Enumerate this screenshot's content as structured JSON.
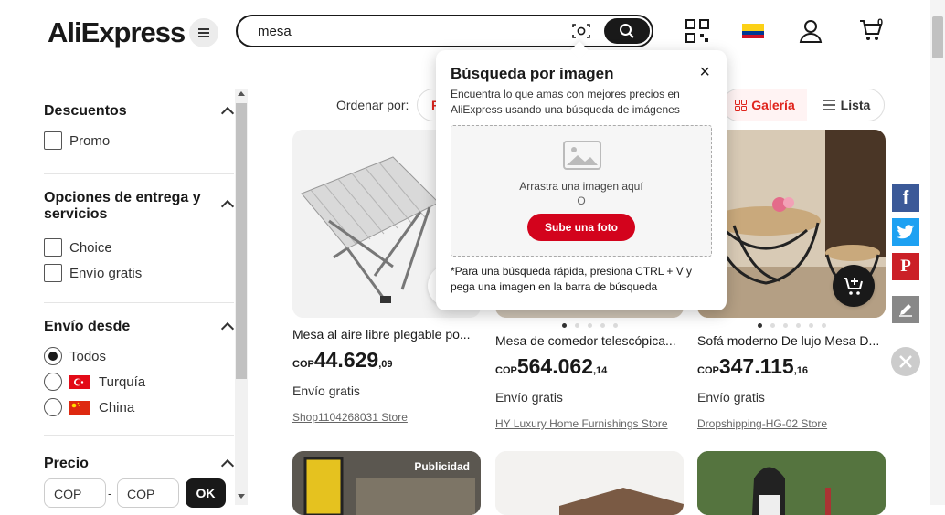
{
  "header": {
    "logo_text": "AliExpress",
    "search_value": "mesa",
    "cart_count": "0",
    "icons": [
      "menu-icon",
      "camera-search-icon",
      "search-icon",
      "qr-code-icon",
      "colombia-flag-icon",
      "user-icon",
      "cart-icon"
    ]
  },
  "sidebar": {
    "discounts": {
      "title": "Descuentos",
      "options": [
        "Promo"
      ]
    },
    "delivery": {
      "title": "Opciones de entrega y servicios",
      "options": [
        "Choice",
        "Envío gratis"
      ]
    },
    "ship_from": {
      "title": "Envío desde",
      "options": [
        "Todos",
        "Turquía",
        "China"
      ],
      "selected": "Todos"
    },
    "price": {
      "title": "Precio",
      "min_placeholder": "COP",
      "max_placeholder": "COP",
      "separator": "-",
      "ok_label": "OK"
    }
  },
  "sort": {
    "label": "Ordenar por:",
    "active_fragment": "F",
    "gallery_label": "Galería",
    "list_label": "Lista"
  },
  "products": [
    {
      "title": "Mesa al aire libre plegable po...",
      "currency": "COP",
      "price_int": "44.629",
      "price_dec": ",09",
      "shipping": "Envío gratis",
      "store": "Shop1104268031 Store"
    },
    {
      "title": "Mesa de comedor telescópica...",
      "currency": "COP",
      "price_int": "564.062",
      "price_dec": ",14",
      "shipping": "Envío gratis",
      "store": "HY Luxury Home Furnishings Store"
    },
    {
      "title": "Sofá moderno De lujo Mesa D...",
      "currency": "COP",
      "price_int": "347.115",
      "price_dec": ",16",
      "shipping": "Envío gratis",
      "store": "Dropshipping-HG-02 Store"
    }
  ],
  "second_row": {
    "ad_label": "Publicidad"
  },
  "image_search_popup": {
    "title": "Búsqueda por imagen",
    "close": "×",
    "description": "Encuentra lo que amas con mejores precios en AliExpress usando una búsqueda de imágenes",
    "drop_text": "Arrastra una imagen aquí",
    "or_text": "O",
    "upload_label": "Sube una foto",
    "tip": "*Para una búsqueda rápida, presiona CTRL + V y pega una imagen en la barra de búsqueda"
  },
  "share": {
    "icons": [
      "facebook-icon",
      "twitter-icon",
      "pinterest-icon",
      "edit-icon",
      "close-icon"
    ],
    "colors": {
      "facebook": "#3b5998",
      "twitter": "#1da1f2",
      "pinterest": "#cb2027",
      "edit": "#888888"
    }
  },
  "colors": {
    "accent": "#e0241c",
    "upload_button": "#d3031c",
    "dark": "#191919"
  }
}
